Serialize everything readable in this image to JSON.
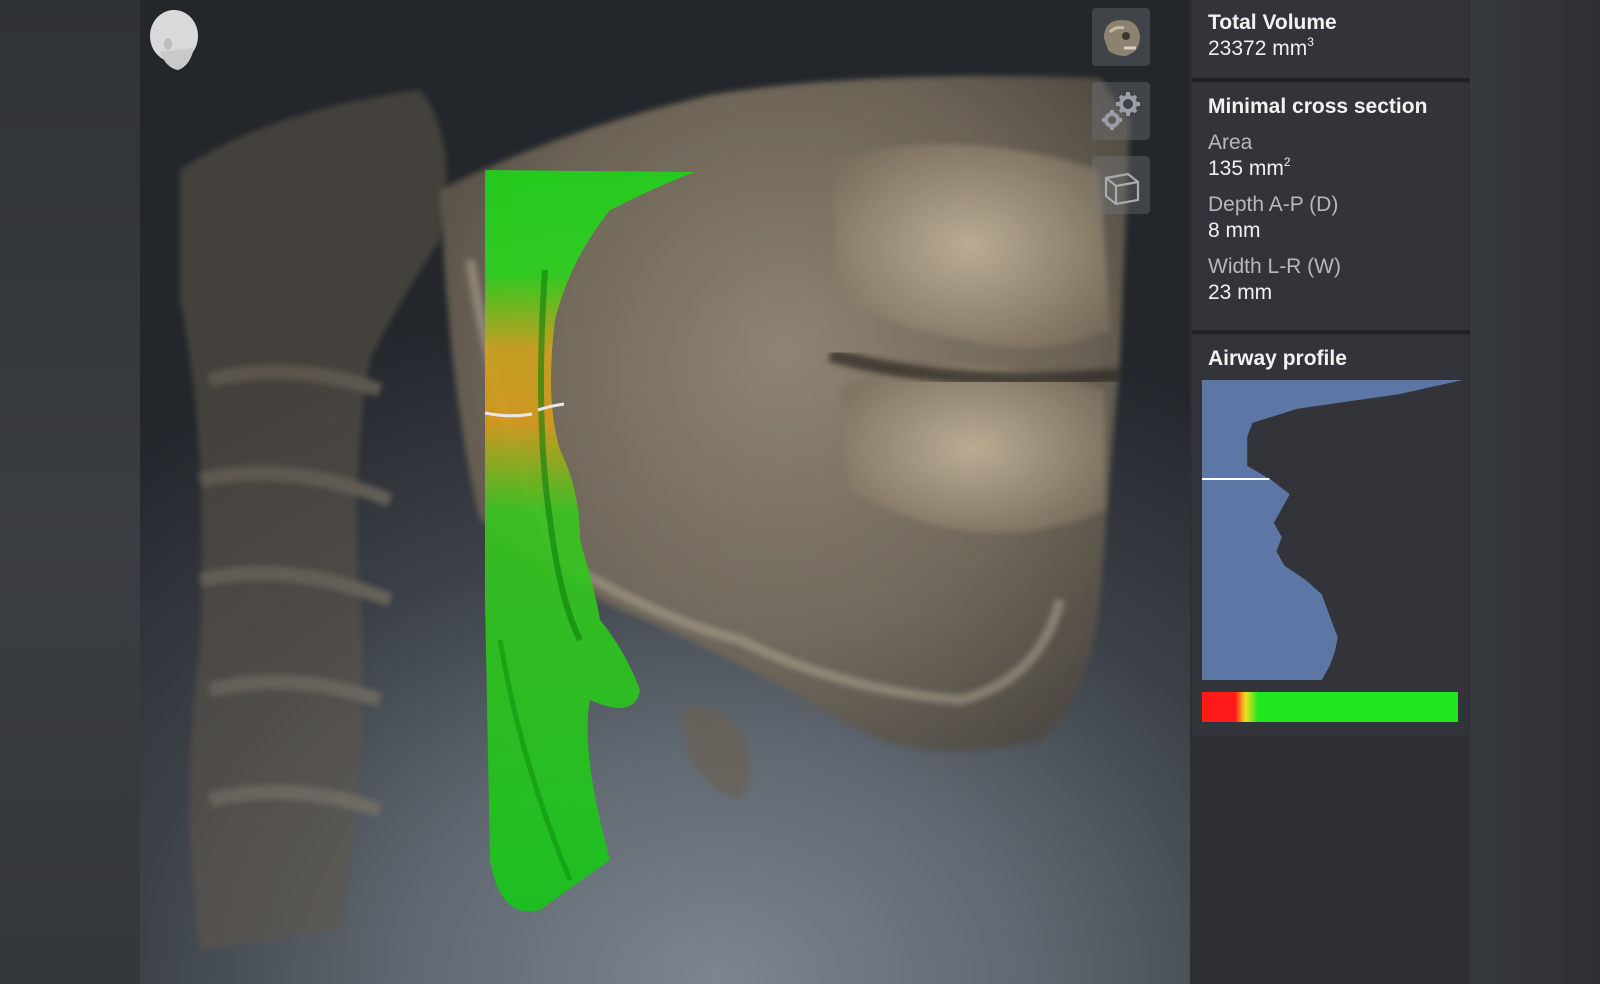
{
  "panel": {
    "total_volume": {
      "title": "Total Volume",
      "value": "23372",
      "unit": "mm",
      "unit_exp": "3"
    },
    "minimal_cross_section": {
      "title": "Minimal cross section",
      "area_label": "Area",
      "area_value": "135",
      "area_unit": "mm",
      "area_unit_exp": "2",
      "depth_label": "Depth A-P (D)",
      "depth_value": "8 mm",
      "width_label": "Width L-R (W)",
      "width_value": "23 mm"
    },
    "airway_profile": {
      "title": "Airway profile"
    }
  },
  "icons": {
    "head_orientation": "head-orientation-icon",
    "skull_view": "skull-view-icon",
    "settings": "gears-icon",
    "cube_view": "cube-icon"
  },
  "colors": {
    "profile_fill": "#5c76a5",
    "profile_marker": "#ffffff",
    "airway_green": "#22d61e",
    "airway_yellow": "#d8a21c",
    "bar_red": "#ff1a1a",
    "bar_yellow": "#f0e020",
    "bar_green": "#1fe61f"
  },
  "chart_data": {
    "type": "area",
    "title": "Airway profile",
    "orientation": "vertical",
    "note_marker_position_fraction": 0.33,
    "profile_width_fraction": [
      0.98,
      0.74,
      0.36,
      0.19,
      0.17,
      0.17,
      0.17,
      0.26,
      0.33,
      0.3,
      0.27,
      0.3,
      0.28,
      0.31,
      0.39,
      0.45,
      0.47,
      0.49,
      0.51,
      0.5,
      0.48,
      0.45
    ],
    "color_scale": [
      {
        "fraction": 0.0,
        "color": "#ff1a1a"
      },
      {
        "fraction": 0.13,
        "color": "#ff1a1a"
      },
      {
        "fraction": 0.17,
        "color": "#f0e020"
      },
      {
        "fraction": 0.22,
        "color": "#1fe61f"
      },
      {
        "fraction": 1.0,
        "color": "#1fe61f"
      }
    ]
  }
}
